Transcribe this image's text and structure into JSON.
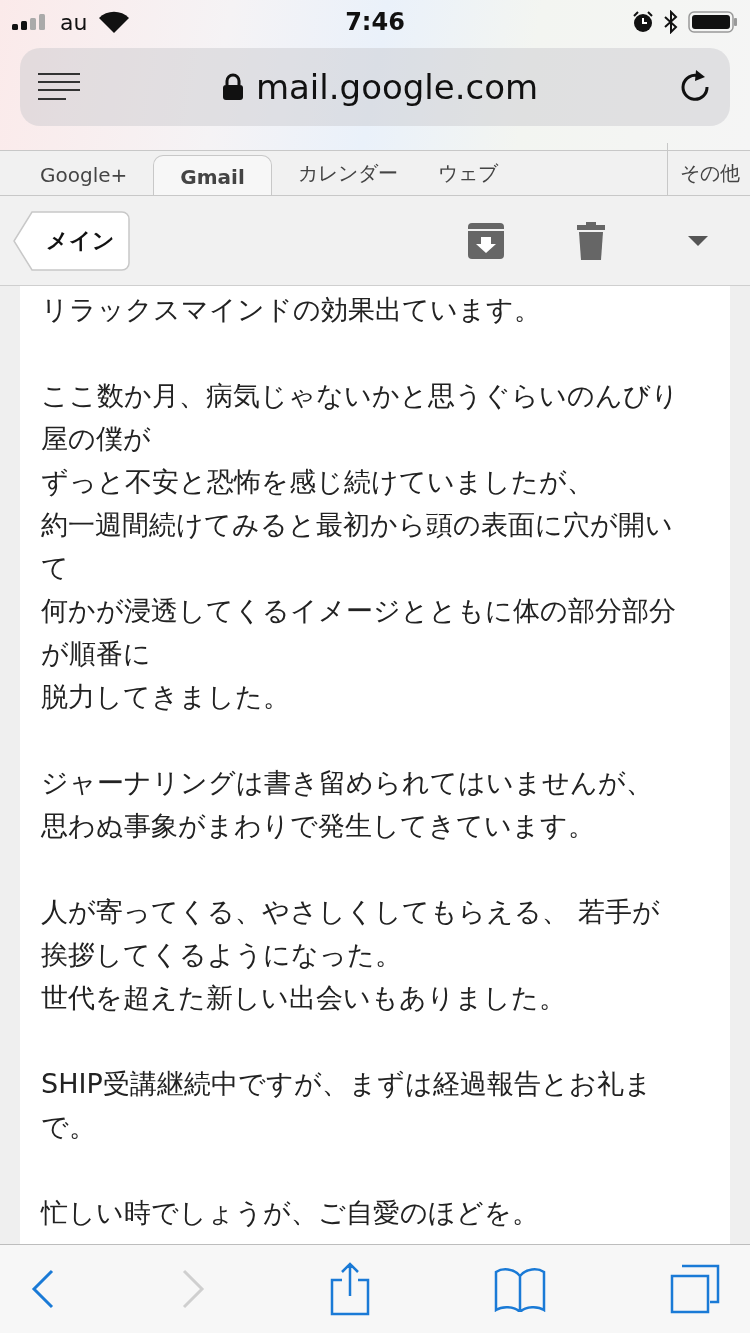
{
  "status_bar": {
    "carrier": "au",
    "time": "7:46"
  },
  "address_bar": {
    "url": "mail.google.com",
    "secure": true
  },
  "tabs": [
    {
      "label": "Google+",
      "selected": false
    },
    {
      "label": "Gmail",
      "selected": true
    },
    {
      "label": "カレンダー",
      "selected": false
    },
    {
      "label": "ウェブ",
      "selected": false
    }
  ],
  "more_tab": "その他",
  "toolbar": {
    "back_label": "メイン"
  },
  "message": {
    "paragraphs": [
      [
        "リラックスマインドの効果出ています。"
      ],
      [
        "ここ数か月、病気じゃないかと思うぐらいのんびり屋の僕が",
        "ずっと不安と恐怖を感じ続けていましたが、",
        "約一週間続けてみると最初から頭の表面に穴が開いて",
        "何かが浸透してくるイメージとともに体の部分部分が順番に",
        "脱力してきました。"
      ],
      [
        "ジャーナリングは書き留められてはいませんが、",
        "思わぬ事象がまわりで発生してきています。"
      ],
      [
        "人が寄ってくる、やさしくしてもらえる、 若手が挨拶してくるようになった。",
        "世代を超えた新しい出会いもありました。"
      ],
      [
        "SHIP受講継続中ですが、まずは経過報告とお礼まで。"
      ],
      [
        "忙しい時でしょうが、ご自愛のほどを。"
      ]
    ]
  },
  "bottom_bar": [
    {
      "kind": "back",
      "disabled": false
    },
    {
      "kind": "forward",
      "disabled": true
    },
    {
      "kind": "share",
      "disabled": false
    },
    {
      "kind": "bookmarks",
      "disabled": false
    },
    {
      "kind": "tabs",
      "disabled": false
    }
  ]
}
